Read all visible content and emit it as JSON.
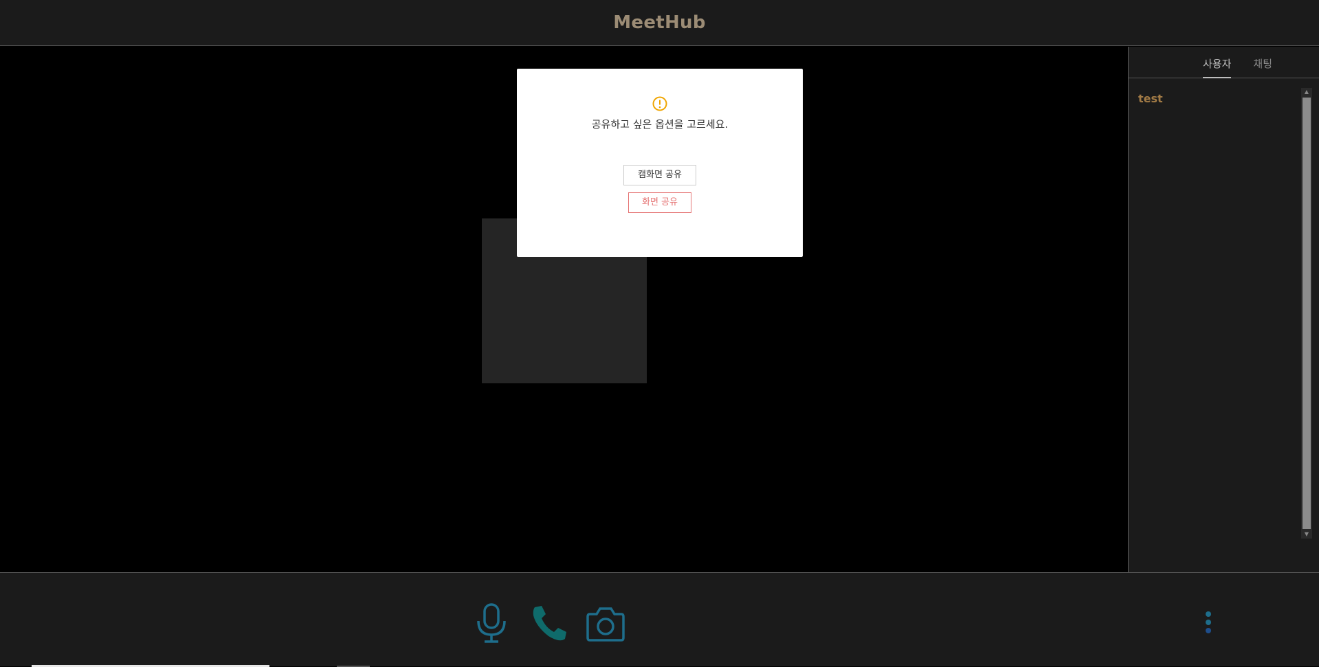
{
  "app": {
    "title": "MeetHub"
  },
  "sidebar": {
    "tabs": [
      {
        "label": "사용자",
        "active": true
      },
      {
        "label": "채팅",
        "active": false
      }
    ],
    "users": [
      "test"
    ]
  },
  "modal": {
    "message": "공유하고 싶은 옵션을 고르세요.",
    "cam_button": "캠화면 공유",
    "screen_button": "화면 공유",
    "icon": "warning-icon"
  },
  "controls": {
    "mic_icon": "microphone-icon",
    "call_icon": "phone-icon",
    "camera_icon": "camera-icon",
    "more_icon": "more-vertical-icon"
  },
  "colors": {
    "brand": "#9c8c75",
    "user_name": "#a17a45",
    "control_blue": "#1e6e8c",
    "warning": "#f0a500",
    "danger": "#e57373"
  }
}
